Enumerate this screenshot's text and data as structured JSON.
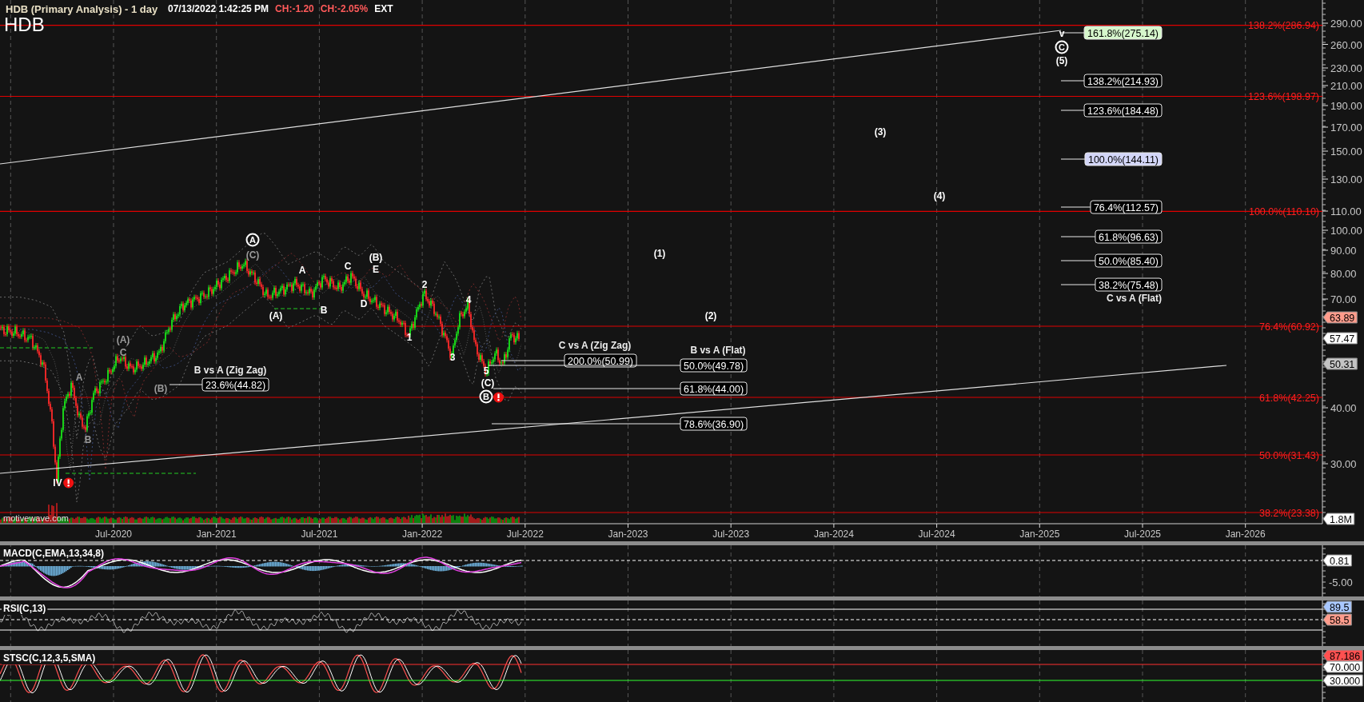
{
  "header": {
    "title": "HDB (Primary Analysis) - 1 day",
    "timestamp": "07/13/2022 1:42:25 PM",
    "change": "CH:-1.20",
    "change_percent": "CH:-2.05%",
    "session": "EXT",
    "symbol": "HDB"
  },
  "price_chart": {
    "price_ticks": [
      "290.00",
      "260.00",
      "230.00",
      "210.00",
      "190.00",
      "170.00",
      "150.00",
      "130.00",
      "110.00",
      "100.00",
      "90.00",
      "80.00",
      "70.00",
      "40.00",
      "30.00"
    ],
    "date_ticks": [
      "Jul-2020",
      "Jan-2021",
      "Jul-2021",
      "Jan-2022",
      "Jul-2022",
      "Jan-2023",
      "Jul-2023",
      "Jan-2024",
      "Jul-2024",
      "Jan-2025",
      "Jul-2025",
      "Jan-2026"
    ],
    "fib_lines": [
      "138.2%(286.94)",
      "123.6%(198.97)",
      "100.0%(110.10)",
      "76.4%(60.92)",
      "61.8%(42.25)",
      "50.0%(31.43)",
      "38.2%(23.38)"
    ],
    "projection_labels": [
      {
        "text": "161.8%(275.14)",
        "color": "#d6f7cc"
      },
      {
        "text": "138.2%(214.93)",
        "color": "#000000"
      },
      {
        "text": "123.6%(184.48)",
        "color": "#000000"
      },
      {
        "text": "100.0%(144.11)",
        "color": "#d3d6f8"
      },
      {
        "text": "76.4%(112.57)",
        "color": "#000000"
      },
      {
        "text": "61.8%(96.63)",
        "color": "#000000"
      },
      {
        "text": "50.0%(85.40)",
        "color": "#000000"
      },
      {
        "text": "38.2%(75.48)",
        "color": "#000000"
      },
      {
        "text": "200.0%(50.99)",
        "color": "#000000"
      },
      {
        "text": "50.0%(49.78)",
        "color": "#000000"
      },
      {
        "text": "23.6%(44.82)",
        "color": "#000000"
      },
      {
        "text": "61.8%(44.00)",
        "color": "#000000"
      },
      {
        "text": "78.6%(36.90)",
        "color": "#000000"
      }
    ],
    "projection_captions": [
      "C vs A (Flat)",
      "C vs A (Zig Zag)",
      "B vs A (Flat)",
      "B vs A (Zig Zag)"
    ],
    "wave_labels": [
      {
        "text": "A",
        "kind": "circled",
        "color": "#ffffff",
        "alert": false
      },
      {
        "text": "(C)",
        "kind": "plain",
        "color": "#9a9a9a",
        "alert": false
      },
      {
        "text": "A",
        "kind": "plain",
        "color": "#ffffff",
        "alert": false
      },
      {
        "text": "C",
        "kind": "plain",
        "color": "#ffffff",
        "alert": false
      },
      {
        "text": "(B)",
        "kind": "plain",
        "color": "#ffffff",
        "alert": false
      },
      {
        "text": "E",
        "kind": "plain",
        "color": "#ffffff",
        "alert": false
      },
      {
        "text": "(A)",
        "kind": "plain",
        "color": "#ffffff",
        "alert": false
      },
      {
        "text": "B",
        "kind": "plain",
        "color": "#ffffff",
        "alert": false
      },
      {
        "text": "D",
        "kind": "plain",
        "color": "#ffffff",
        "alert": false
      },
      {
        "text": "2",
        "kind": "plain",
        "color": "#ffffff",
        "alert": false
      },
      {
        "text": "4",
        "kind": "plain",
        "color": "#ffffff",
        "alert": false
      },
      {
        "text": "1",
        "kind": "plain",
        "color": "#ffffff",
        "alert": false
      },
      {
        "text": "3",
        "kind": "plain",
        "color": "#ffffff",
        "alert": false
      },
      {
        "text": "5",
        "kind": "plain",
        "color": "#ffffff",
        "alert": false
      },
      {
        "text": "(C)",
        "kind": "plain",
        "color": "#ffffff",
        "alert": false
      },
      {
        "text": "B",
        "kind": "circled",
        "color": "#ffffff",
        "alert": true
      },
      {
        "text": "(A)",
        "kind": "plain",
        "color": "#9a9a9a",
        "alert": false
      },
      {
        "text": "C",
        "kind": "plain",
        "color": "#9a9a9a",
        "alert": false
      },
      {
        "text": "(B)",
        "kind": "plain",
        "color": "#9a9a9a",
        "alert": false
      },
      {
        "text": "A",
        "kind": "plain",
        "color": "#9a9a9a",
        "alert": false
      },
      {
        "text": "B",
        "kind": "plain",
        "color": "#9a9a9a",
        "alert": false
      },
      {
        "text": "IV",
        "kind": "plain",
        "color": "#ffffff",
        "alert": true
      },
      {
        "text": "(1)",
        "kind": "plain",
        "color": "#ffffff",
        "alert": false
      },
      {
        "text": "(2)",
        "kind": "plain",
        "color": "#ffffff",
        "alert": false
      },
      {
        "text": "(3)",
        "kind": "plain",
        "color": "#ffffff",
        "alert": false
      },
      {
        "text": "(4)",
        "kind": "plain",
        "color": "#ffffff",
        "alert": false
      },
      {
        "text": "v",
        "kind": "plain",
        "color": "#ffffff",
        "alert": false
      },
      {
        "text": "C",
        "kind": "circled",
        "color": "#ffffff",
        "alert": false
      },
      {
        "text": "(5)",
        "kind": "plain",
        "color": "#ffffff",
        "alert": false
      }
    ],
    "price_markers": [
      {
        "text": "63.89",
        "color": "#ff9c8c"
      },
      {
        "text": "57.47",
        "color": "#ffffff"
      },
      {
        "text": "50.31",
        "color": "#c4c4c4"
      },
      {
        "text": "1.8M",
        "color": "#ffffff"
      }
    ],
    "source_label": "motivewave.com"
  },
  "indicators": [
    {
      "title": "MACD(C,EMA,13,34,8)",
      "kind": "macd",
      "ticks": [
        "-5.00"
      ],
      "markers": [
        {
          "text": "0.81",
          "color": "#ffffff"
        }
      ]
    },
    {
      "title": "RSI(C,13)",
      "kind": "rsi",
      "markers": [
        {
          "text": "89.5",
          "color": "#a9c8ff"
        },
        {
          "text": "58.5",
          "color": "#ff9c8c"
        }
      ]
    },
    {
      "title": "STSC(C,12,3,5,SMA)",
      "kind": "stsc",
      "markers": [
        {
          "text": "87.186",
          "color": "#ff5050"
        },
        {
          "text": "70.000",
          "color": "#ffffff"
        },
        {
          "text": "30.000",
          "color": "#ffffff"
        }
      ]
    }
  ]
}
